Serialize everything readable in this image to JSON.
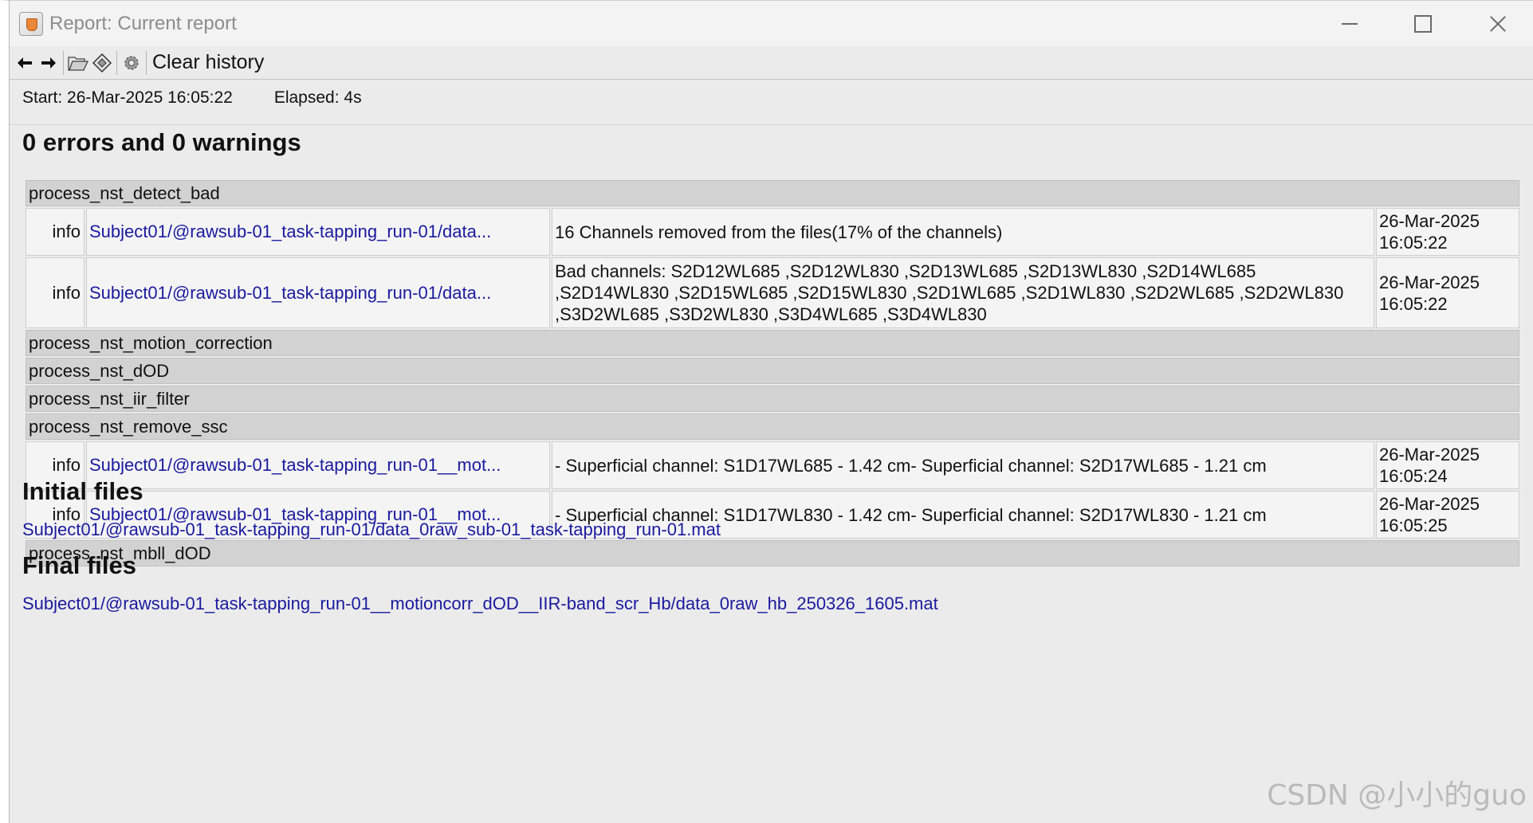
{
  "window": {
    "title": "Report: Current report"
  },
  "toolbar": {
    "clear_label": "Clear history"
  },
  "meta": {
    "start": "Start: 26-Mar-2025 16:05:22",
    "elapsed": "Elapsed: 4s"
  },
  "summary": "0 errors and 0 warnings",
  "processes": [
    {
      "name": "process_nst_detect_bad",
      "entries": [
        {
          "level": "info",
          "file": "Subject01/@rawsub-01_task-tapping_run-01/data...",
          "message": "16 Channels removed from the files(17% of the channels)",
          "date": "26-Mar-2025",
          "time": "16:05:22"
        },
        {
          "level": "info",
          "file": "Subject01/@rawsub-01_task-tapping_run-01/data...",
          "message": "Bad channels: S2D12WL685 ,S2D12WL830 ,S2D13WL685 ,S2D13WL830 ,S2D14WL685 ,S2D14WL830 ,S2D15WL685 ,S2D15WL830 ,S2D1WL685 ,S2D1WL830 ,S2D2WL685 ,S2D2WL830 ,S3D2WL685 ,S3D2WL830 ,S3D4WL685 ,S3D4WL830",
          "date": "26-Mar-2025",
          "time": "16:05:22"
        }
      ]
    },
    {
      "name": "process_nst_motion_correction",
      "entries": []
    },
    {
      "name": "process_nst_dOD",
      "entries": []
    },
    {
      "name": "process_nst_iir_filter",
      "entries": []
    },
    {
      "name": "process_nst_remove_ssc",
      "entries": [
        {
          "level": "info",
          "file": "Subject01/@rawsub-01_task-tapping_run-01__mot...",
          "message": "- Superficial channel: S1D17WL685 - 1.42 cm- Superficial channel: S2D17WL685 - 1.21 cm",
          "date": "26-Mar-2025",
          "time": "16:05:24"
        },
        {
          "level": "info",
          "file": "Subject01/@rawsub-01_task-tapping_run-01__mot...",
          "message": "- Superficial channel: S1D17WL830 - 1.42 cm- Superficial channel: S2D17WL830 - 1.21 cm",
          "date": "26-Mar-2025",
          "time": "16:05:25"
        }
      ]
    },
    {
      "name": "process_nst_mbll_dOD",
      "entries": []
    }
  ],
  "initial_files": {
    "heading": "Initial files",
    "file": "Subject01/@rawsub-01_task-tapping_run-01/data_0raw_sub-01_task-tapping_run-01.mat"
  },
  "final_files": {
    "heading": "Final files",
    "file": "Subject01/@rawsub-01_task-tapping_run-01__motioncorr_dOD__IIR-band_scr_Hb/data_0raw_hb_250326_1605.mat"
  },
  "watermark": "CSDN @小小的guo"
}
